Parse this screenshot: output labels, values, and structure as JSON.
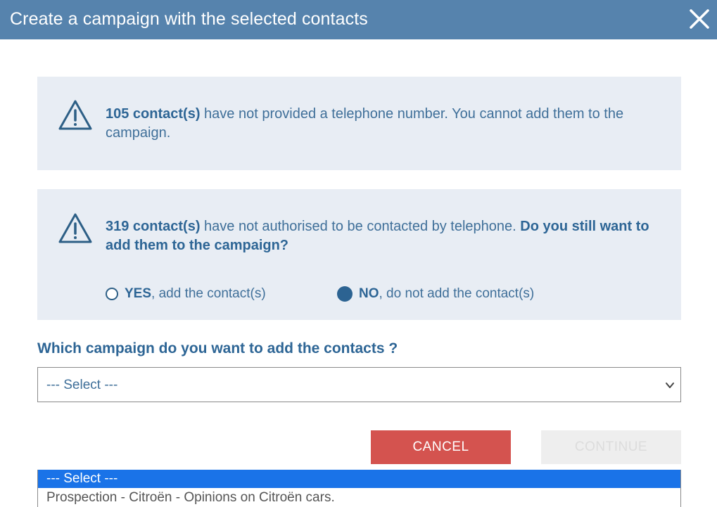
{
  "dialog": {
    "title": "Create a campaign with the selected contacts"
  },
  "warnings": [
    {
      "count_label": "105 contact(s)",
      "text": " have not provided a telephone number. You cannot add them to the campaign."
    },
    {
      "count_label": "319 contact(s)",
      "text": " have not authorised to be contacted by telephone. ",
      "question": "Do you still want to add them to the campaign?"
    }
  ],
  "options": {
    "yes_bold": "YES",
    "yes_rest": ", add the contact(s)",
    "no_bold": "NO",
    "no_rest": ", do not add the contact(s)",
    "selected": "no"
  },
  "campaign": {
    "question": "Which campaign do you want to add the contacts ?",
    "select_value": "--- Select ---",
    "dropdown_options": [
      "--- Select ---",
      "Prospection - Citroën - Opinions on Citroën cars."
    ]
  },
  "buttons": {
    "cancel": "CANCEL",
    "continue": "CONTINUE"
  },
  "colors": {
    "titlebar": "#5683ad",
    "panel": "#e8edf4",
    "text_blue": "#3f6f99",
    "cancel_red": "#d4534f",
    "option_highlight": "#1a73e8"
  },
  "icons": {
    "close": "close-icon",
    "warning": "warning-triangle-icon",
    "chevron": "chevron-down-icon"
  }
}
